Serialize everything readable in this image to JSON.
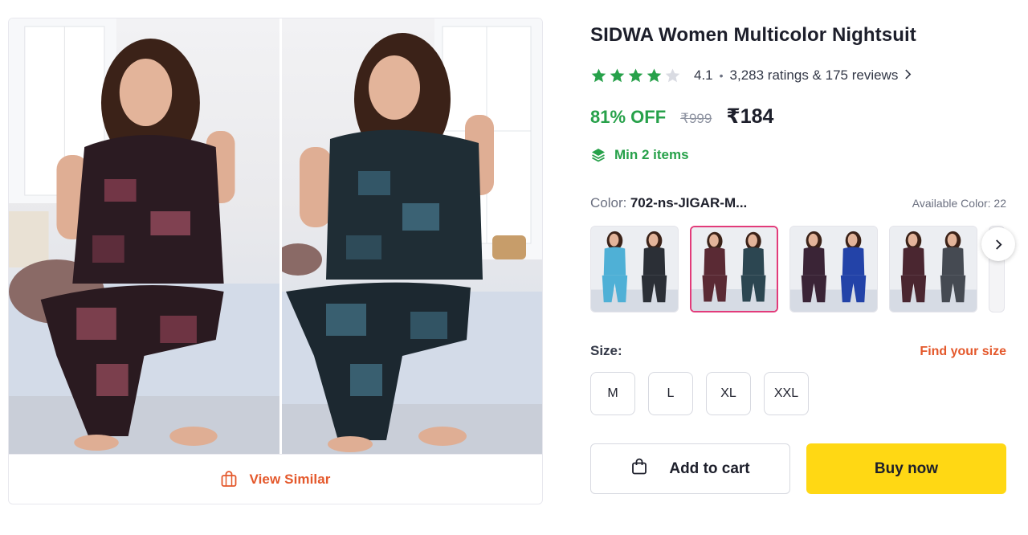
{
  "product": {
    "title": "SIDWA Women Multicolor Nightsuit",
    "rating": "4.1",
    "rating_summary": "3,283 ratings & 175 reviews",
    "rating_stars_filled": 4,
    "rating_stars_total": 5,
    "discount": "81% OFF",
    "mrp": "₹999",
    "price": "₹184",
    "min_items": "Min 2 items"
  },
  "gallery": {
    "view_similar_label": "View Similar",
    "images": [
      "model-in-maroon-nightsuit",
      "model-in-teal-nightsuit"
    ]
  },
  "color": {
    "label": "Color:",
    "selected": "702-ns-JIGAR-M...",
    "available": "Available Color: 22",
    "swatches": [
      {
        "name": "sky-blue-and-black",
        "colors": [
          "#4fb0d6",
          "#2b2f36"
        ],
        "selected": false
      },
      {
        "name": "maroon-and-teal",
        "colors": [
          "#5a2a34",
          "#2c4651"
        ],
        "selected": true
      },
      {
        "name": "purple-and-blue",
        "colors": [
          "#3a2436",
          "#2343a8"
        ],
        "selected": false
      },
      {
        "name": "maroon-and-grey",
        "colors": [
          "#4a2630",
          "#454a52"
        ],
        "selected": false
      }
    ]
  },
  "size": {
    "label": "Size:",
    "find_label": "Find your size",
    "options": [
      "M",
      "L",
      "XL",
      "XXL"
    ]
  },
  "actions": {
    "add_to_cart": "Add to cart",
    "buy_now": "Buy now"
  },
  "colors": {
    "accent_orange": "#e4582b",
    "green": "#27a14a",
    "buy_yellow": "#ffd814",
    "selected_pink": "#e23b7a"
  }
}
